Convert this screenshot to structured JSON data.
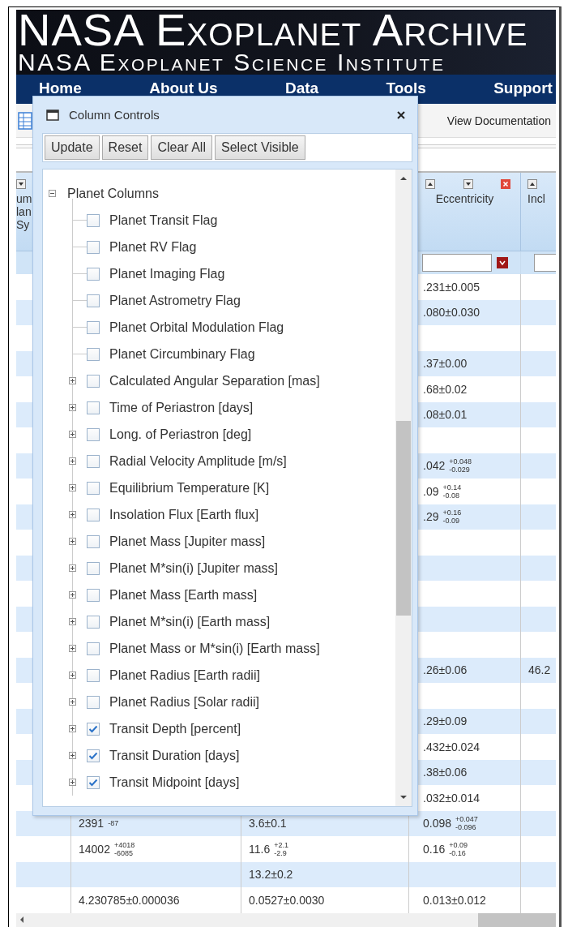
{
  "banner": {
    "title": "NASA Exoplanet Archive",
    "subtitle": "NASA Exoplanet Science Institute"
  },
  "nav": [
    "Home",
    "About Us",
    "Data",
    "Tools",
    "Support"
  ],
  "toolbar": {
    "link": "View Documentation"
  },
  "table": {
    "columns": [
      {
        "header": [
          "um",
          "lan",
          "Sy"
        ]
      },
      {},
      {},
      {
        "header": [
          "Eccentricity"
        ],
        "filter": true
      },
      {
        "header": [
          "Incl"
        ],
        "filter": true
      }
    ],
    "rows": [
      [
        null,
        null,
        null,
        ".231±0.005",
        null
      ],
      [
        null,
        null,
        null,
        ".080±0.030",
        null
      ],
      [
        null,
        null,
        null,
        null,
        null
      ],
      [
        null,
        null,
        null,
        ".37±0.00",
        null
      ],
      [
        null,
        null,
        null,
        ".68±0.02",
        null
      ],
      [
        null,
        null,
        null,
        ".08±0.01",
        null
      ],
      [
        null,
        null,
        null,
        null,
        null
      ],
      [
        null,
        null,
        null,
        {
          "value": ".042",
          "plus": "+0.048",
          "minus": "-0.029"
        },
        null
      ],
      [
        null,
        null,
        null,
        {
          "value": ".09",
          "plus": "+0.14",
          "minus": "-0.08"
        },
        null
      ],
      [
        null,
        null,
        null,
        {
          "value": ".29",
          "plus": "+0.16",
          "minus": "-0.09"
        },
        null
      ],
      [
        null,
        null,
        null,
        null,
        null
      ],
      [
        null,
        null,
        null,
        null,
        null
      ],
      [
        null,
        null,
        null,
        null,
        null
      ],
      [
        null,
        null,
        null,
        null,
        null
      ],
      [
        null,
        null,
        null,
        null,
        null
      ],
      [
        null,
        null,
        null,
        ".26±0.06",
        "46.2"
      ],
      [
        null,
        null,
        null,
        null,
        null
      ],
      [
        null,
        null,
        null,
        ".29±0.09",
        null
      ],
      [
        null,
        null,
        null,
        ".432±0.024",
        null
      ],
      [
        null,
        null,
        null,
        ".38±0.06",
        null
      ],
      [
        null,
        null,
        null,
        ".032±0.014",
        null
      ],
      [
        null,
        {
          "value": "2391",
          "minus": "-87"
        },
        "3.6±0.1",
        {
          "value": "0.098",
          "plus": "+0.047",
          "minus": "-0.096"
        },
        null
      ],
      [
        null,
        {
          "value": "14002",
          "plus": "+4018",
          "minus": "-6085"
        },
        {
          "value": "11.6",
          "plus": "+2.1",
          "minus": "-2.9"
        },
        {
          "value": "0.16",
          "plus": "+0.09",
          "minus": "-0.16"
        },
        null
      ],
      [
        null,
        null,
        "13.2±0.2",
        null,
        null
      ],
      [
        null,
        "4.230785±0.000036",
        "0.0527±0.0030",
        "0.013±0.012",
        null
      ]
    ]
  },
  "dialog": {
    "title": "Column Controls",
    "buttons": [
      "Update",
      "Reset",
      "Clear All",
      "Select Visible"
    ],
    "tree": [
      {
        "kind": "folder",
        "label": "Planet Columns",
        "expanded": true,
        "children": [
          {
            "kind": "leaf",
            "label": "Planet Transit Flag",
            "checked": false
          },
          {
            "kind": "leaf",
            "label": "Planet RV Flag",
            "checked": false
          },
          {
            "kind": "leaf",
            "label": "Planet Imaging Flag",
            "checked": false
          },
          {
            "kind": "leaf",
            "label": "Planet Astrometry Flag",
            "checked": false
          },
          {
            "kind": "leaf",
            "label": "Planet Orbital Modulation Flag",
            "checked": false
          },
          {
            "kind": "leaf",
            "label": "Planet Circumbinary Flag",
            "checked": false
          },
          {
            "kind": "group",
            "label": "Calculated Angular Separation [mas]",
            "checked": false,
            "expanded": false
          },
          {
            "kind": "group",
            "label": "Time of Periastron [days]",
            "checked": false,
            "expanded": false
          },
          {
            "kind": "group",
            "label": "Long. of Periastron [deg]",
            "checked": false,
            "expanded": false
          },
          {
            "kind": "group",
            "label": "Radial Velocity Amplitude [m/s]",
            "checked": false,
            "expanded": false
          },
          {
            "kind": "group",
            "label": "Equilibrium Temperature [K]",
            "checked": false,
            "expanded": false
          },
          {
            "kind": "group",
            "label": "Insolation Flux [Earth flux]",
            "checked": false,
            "expanded": false
          },
          {
            "kind": "group",
            "label": "Planet Mass [Jupiter mass]",
            "checked": false,
            "expanded": false
          },
          {
            "kind": "group",
            "label": "Planet M*sin(i) [Jupiter mass]",
            "checked": false,
            "expanded": false
          },
          {
            "kind": "group",
            "label": "Planet Mass [Earth mass]",
            "checked": false,
            "expanded": false
          },
          {
            "kind": "group",
            "label": "Planet M*sin(i) [Earth mass]",
            "checked": false,
            "expanded": false
          },
          {
            "kind": "group",
            "label": "Planet Mass or M*sin(i) [Earth mass]",
            "checked": false,
            "expanded": false
          },
          {
            "kind": "group",
            "label": "Planet Radius [Earth radii]",
            "checked": false,
            "expanded": false
          },
          {
            "kind": "group",
            "label": "Planet Radius [Solar radii]",
            "checked": false,
            "expanded": false
          },
          {
            "kind": "group",
            "label": "Transit Depth [percent]",
            "checked": true,
            "expanded": false
          },
          {
            "kind": "group",
            "label": "Transit Duration [days]",
            "checked": true,
            "expanded": false
          },
          {
            "kind": "group",
            "label": "Transit Midpoint [days]",
            "checked": true,
            "expanded": false
          }
        ]
      }
    ]
  }
}
